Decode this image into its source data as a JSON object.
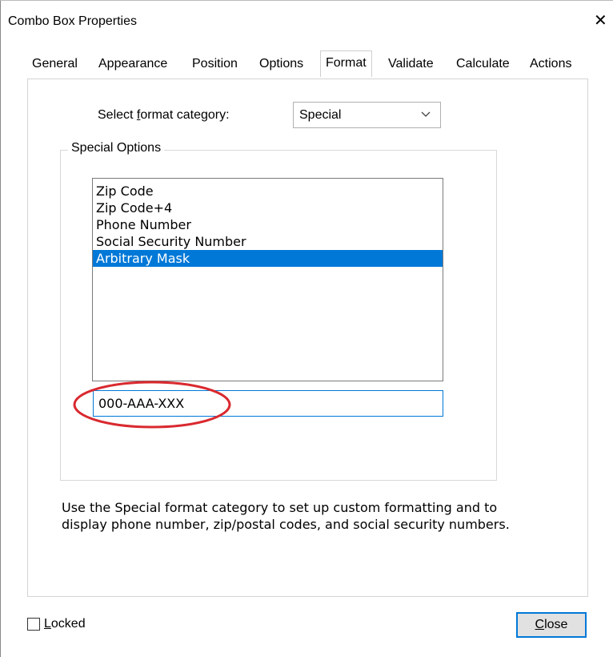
{
  "window": {
    "title": "Combo Box Properties",
    "close_symbol": "✕"
  },
  "tabs": [
    {
      "label": "General"
    },
    {
      "label": "Appearance"
    },
    {
      "label": "Position"
    },
    {
      "label": "Options"
    },
    {
      "label": "Format",
      "active": true
    },
    {
      "label": "Validate"
    },
    {
      "label": "Calculate"
    },
    {
      "label": "Actions"
    }
  ],
  "format": {
    "label_before": "Select ",
    "label_mnemonic": "f",
    "label_after": "ormat category:",
    "selected": "Special"
  },
  "special_options": {
    "legend": "Special Options",
    "items": [
      {
        "label": "Zip Code"
      },
      {
        "label": "Zip Code+4"
      },
      {
        "label": "Phone Number"
      },
      {
        "label": "Social Security Number"
      },
      {
        "label": "Arbitrary Mask",
        "selected": true
      }
    ],
    "mask_value": "000-AAA-XXX"
  },
  "description": "Use the Special format category to set up custom formatting and to display phone number, zip/postal codes, and social security numbers.",
  "footer": {
    "locked_mnemonic": "L",
    "locked_rest": "ocked",
    "close_mnemonic": "C",
    "close_rest": "lose"
  },
  "colors": {
    "accent": "#0078d7",
    "highlight_circle": "#d9292f"
  }
}
